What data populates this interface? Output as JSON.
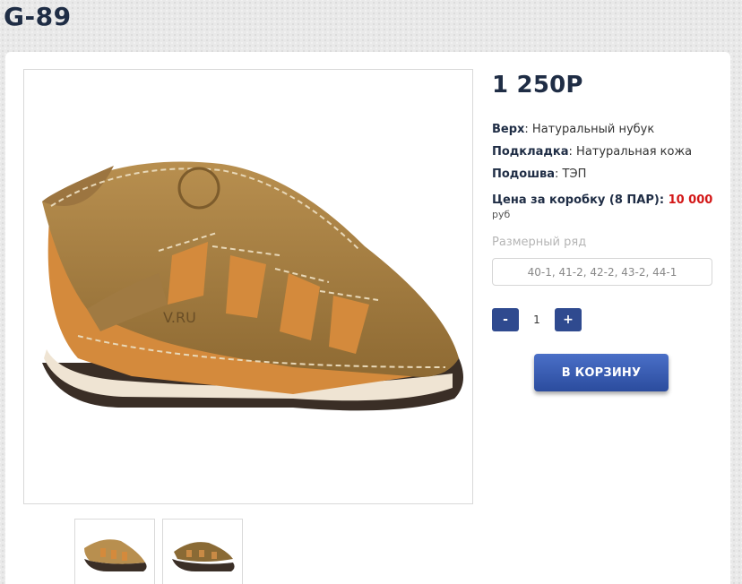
{
  "title": "G-89",
  "product": {
    "price": "1 250P",
    "specs": [
      {
        "label": "Верх",
        "value": ": Натуральный нубук"
      },
      {
        "label": "Подкладка",
        "value": ": Натуральная кожа"
      },
      {
        "label": "Подошва",
        "value": ": ТЭП"
      }
    ],
    "box_price_label": "Цена за коробку (8 ПАР): ",
    "box_price_value": "10 000",
    "currency": "руб",
    "size_label": "Размерный ряд",
    "size_value": "40-1, 41-2, 42-2, 43-2, 44-1",
    "qty_minus": "-",
    "qty_value": "1",
    "qty_plus": "+",
    "cart_button": "В КОРЗИНУ",
    "image_watermark": "V.RU"
  },
  "colors": {
    "accent": "#2f4a8f",
    "price_red": "#d31717",
    "title": "#1f2d45"
  },
  "icons": {
    "main": "sandal-product-image",
    "thumb1": "sandal-thumbnail",
    "thumb2": "sandal-thumbnail-side"
  }
}
